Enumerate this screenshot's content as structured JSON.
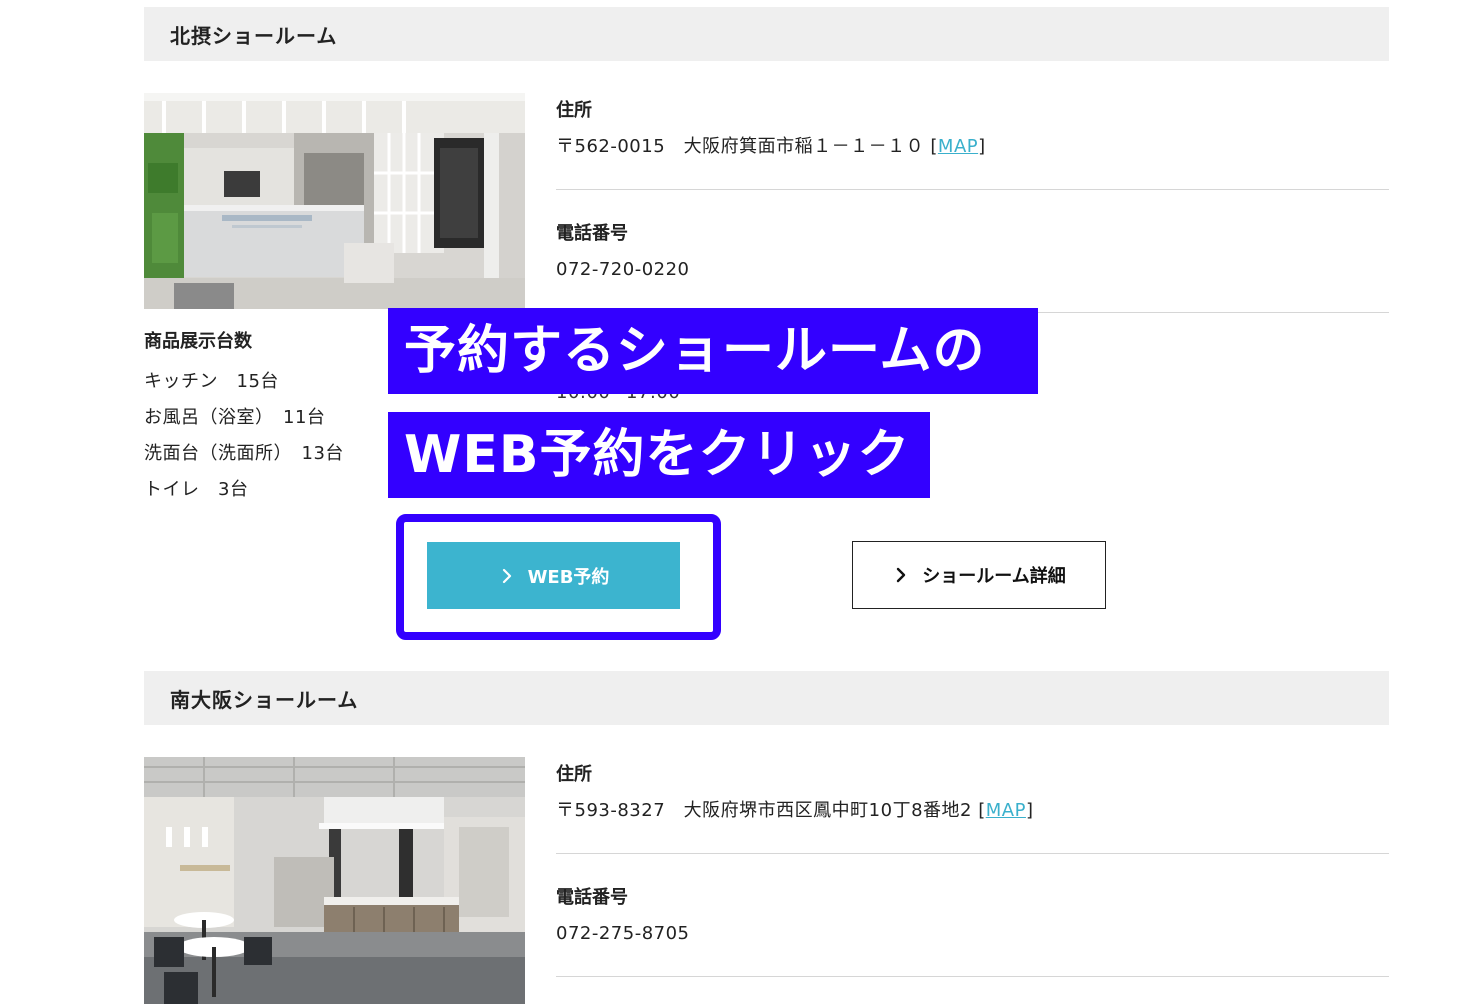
{
  "showrooms": [
    {
      "name": "北摂ショールーム",
      "address_label": "住所",
      "postal": "〒562-0015",
      "address": "大阪府箕面市稲１－１－１０",
      "map_link": "MAP",
      "phone_label": "電話番号",
      "phone": "072-720-0220",
      "hours_partial": "10:00~17:00",
      "display_title": "商品展示台数",
      "display_items": [
        "キッチン　15台",
        "お風呂（浴室）　11台",
        "洗面台（洗面所）　13台",
        "トイレ　3台"
      ],
      "web_button": "WEB予約",
      "detail_button": "ショールーム詳細"
    },
    {
      "name": "南大阪ショールーム",
      "address_label": "住所",
      "postal": "〒593-8327",
      "address": "大阪府堺市西区鳳中町10丁8番地2",
      "map_link": "MAP",
      "phone_label": "電話番号",
      "phone": "072-275-8705"
    }
  ],
  "annotation": {
    "line1": "予約するショールームの",
    "line2": "WEB予約をクリック",
    "color": "#3300ff"
  },
  "colors": {
    "accent": "#3cb4cf",
    "header_bg": "#efefef",
    "link": "#3ab0cc"
  }
}
